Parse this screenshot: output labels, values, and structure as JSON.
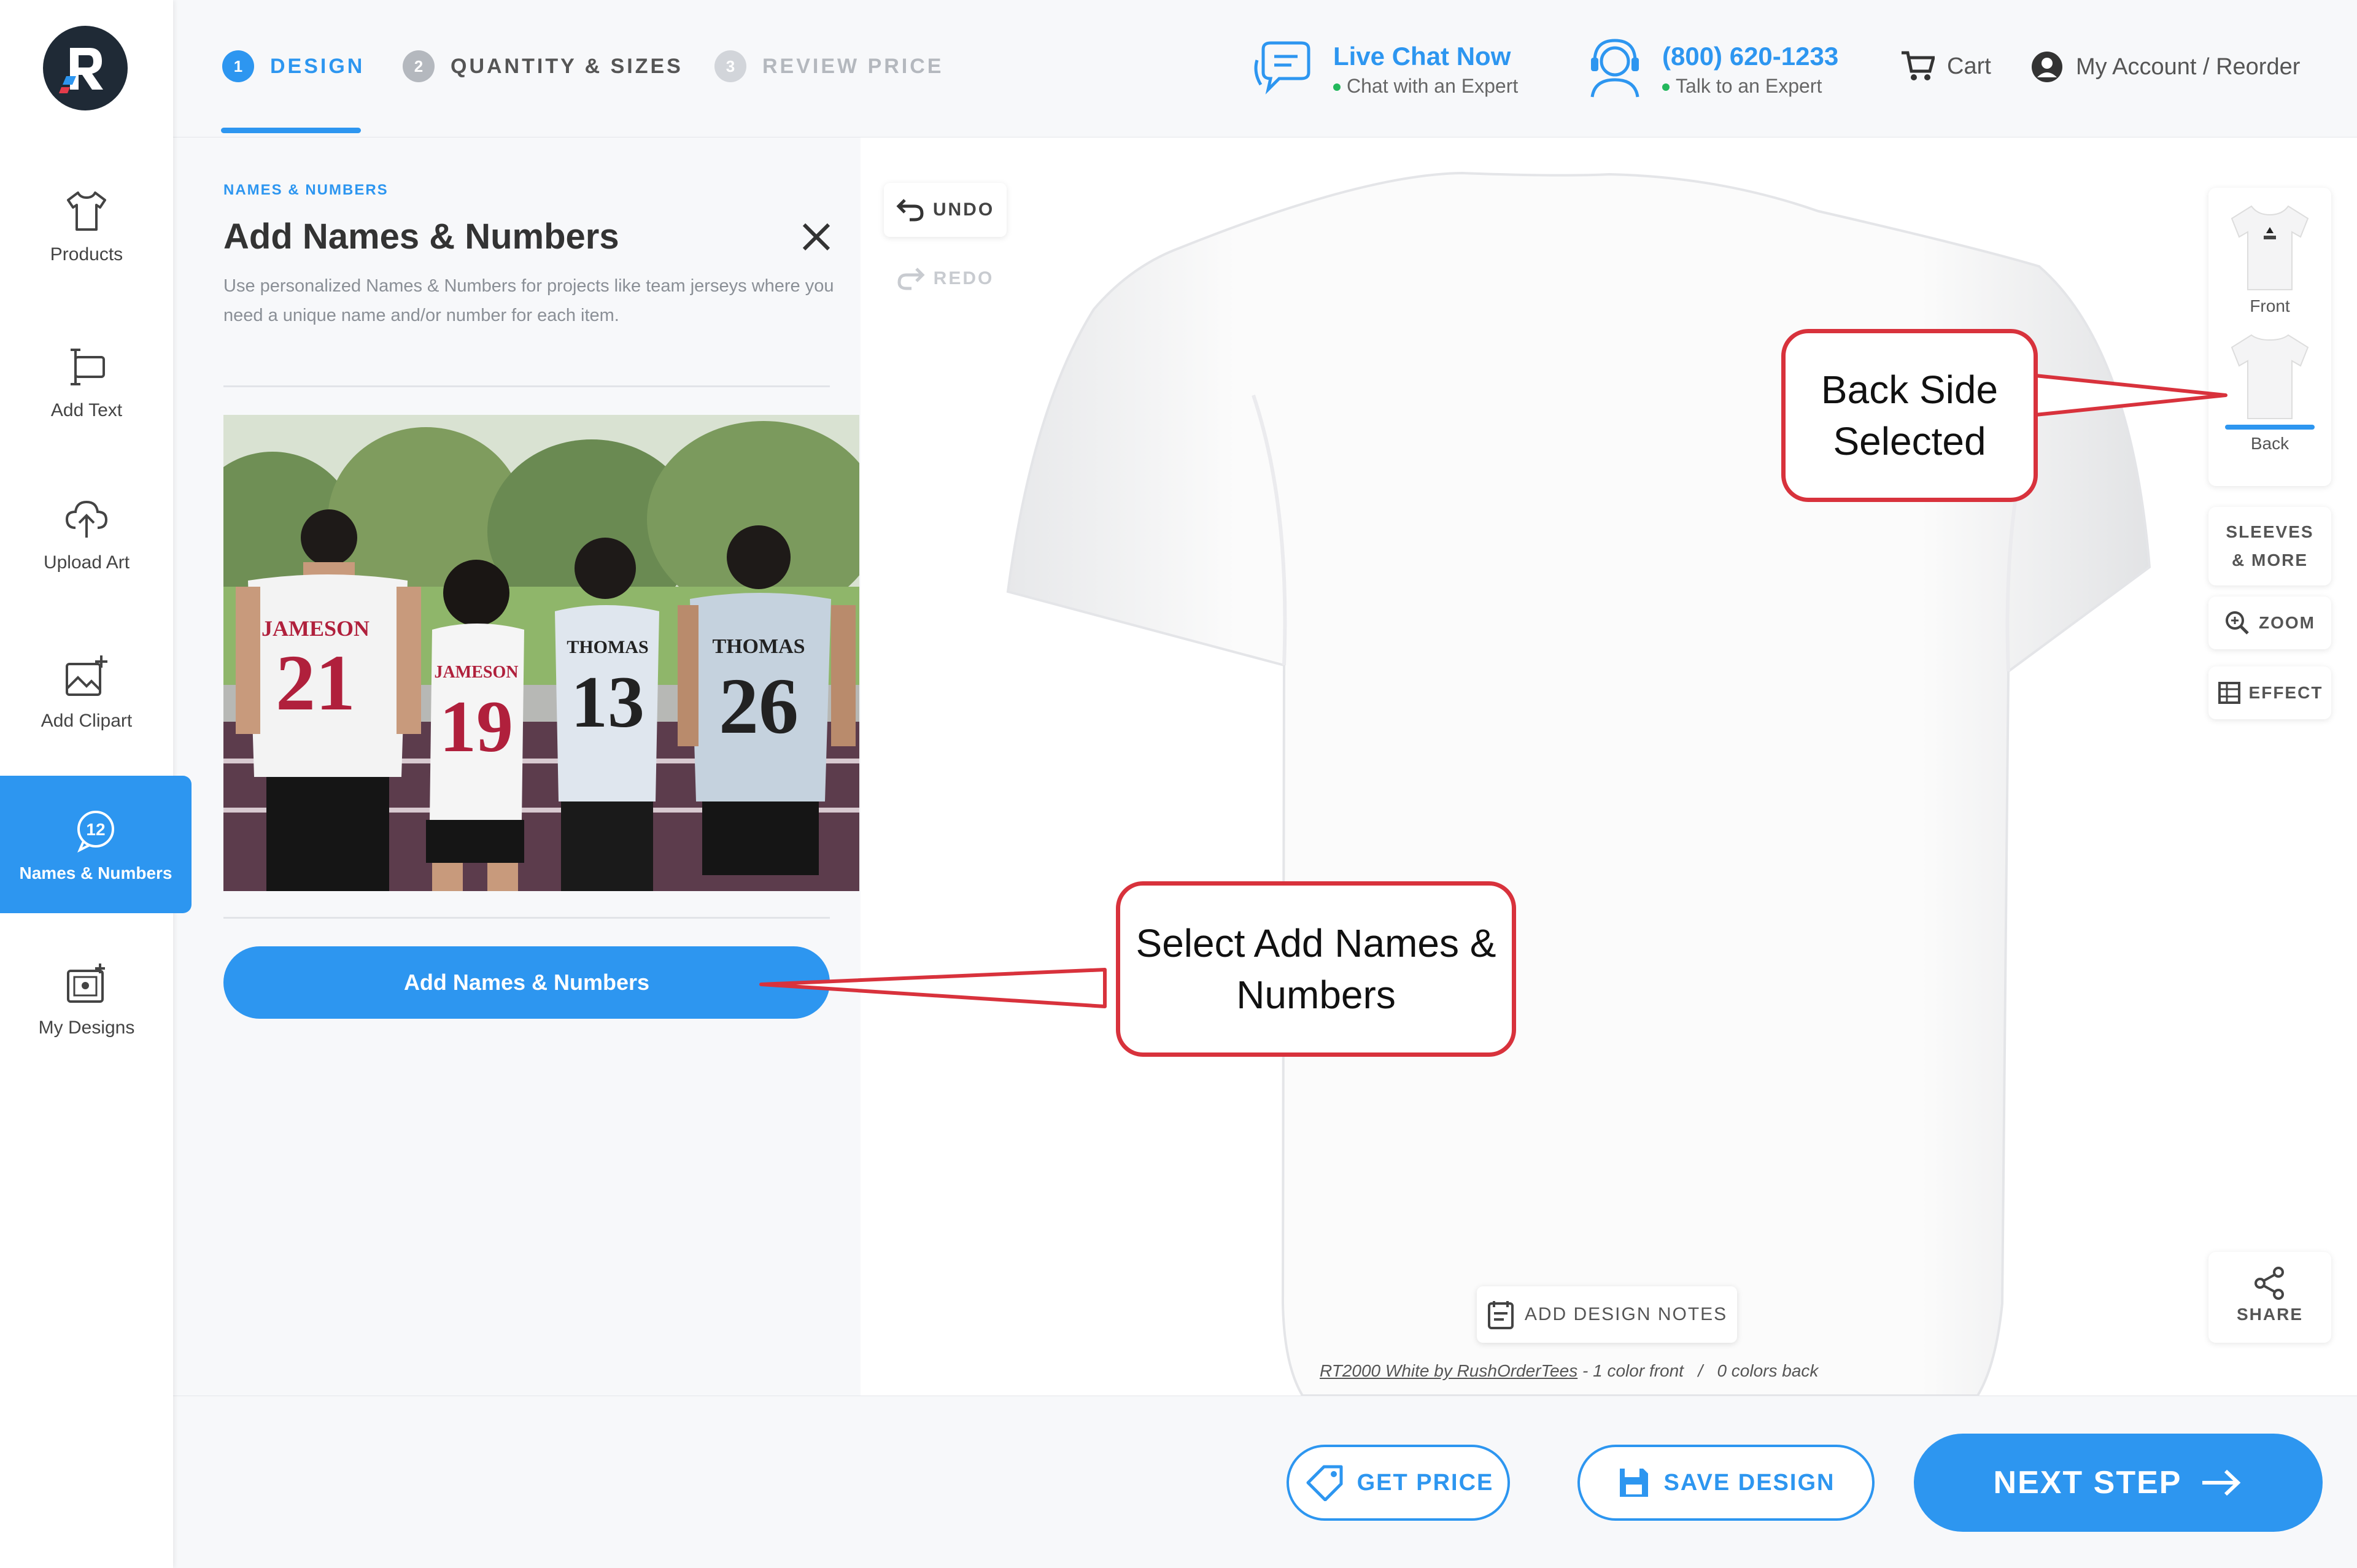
{
  "brand": {
    "logo_alt": "R logo"
  },
  "colors": {
    "accent": "#2d96f0",
    "callout_border": "#d8323c",
    "online_dot": "#23b85c"
  },
  "steps": [
    {
      "num": "1",
      "label": "DESIGN",
      "state": "active"
    },
    {
      "num": "2",
      "label": "QUANTITY & SIZES",
      "state": "next"
    },
    {
      "num": "3",
      "label": "REVIEW PRICE",
      "state": "disabled"
    }
  ],
  "header": {
    "chat_title": "Live Chat Now",
    "chat_sub": "Chat with an Expert",
    "phone_title": "(800) 620-1233",
    "phone_sub": "Talk to an Expert",
    "cart": "Cart",
    "account": "My Account / Reorder"
  },
  "sidebar": {
    "items": [
      {
        "label": "Products",
        "icon": "tshirt-icon"
      },
      {
        "label": "Add Text",
        "icon": "text-cursor-icon"
      },
      {
        "label": "Upload Art",
        "icon": "cloud-upload-icon"
      },
      {
        "label": "Add Clipart",
        "icon": "image-plus-icon"
      },
      {
        "label": "Names & Numbers",
        "icon": "number-badge-icon",
        "badge": "12"
      },
      {
        "label": "My Designs",
        "icon": "gallery-icon"
      }
    ]
  },
  "panel": {
    "kicker": "NAMES & NUMBERS",
    "title": "Add Names & Numbers",
    "description": "Use personalized Names & Numbers for projects like team jerseys where you need a unique name and/or number for each item.",
    "button": "Add Names & Numbers",
    "photo": {
      "jerseys": [
        {
          "name": "JAMESON",
          "number": "21",
          "color": "#b0203c"
        },
        {
          "name": "JAMESON",
          "number": "19",
          "color": "#b0203c"
        },
        {
          "name": "THOMAS",
          "number": "13",
          "color": "#222"
        },
        {
          "name": "THOMAS",
          "number": "26",
          "color": "#222"
        }
      ]
    }
  },
  "canvas": {
    "undo": "UNDO",
    "redo": "REDO",
    "views": [
      {
        "label": "Front"
      },
      {
        "label": "Back",
        "selected": true
      }
    ],
    "tools": [
      {
        "label": "SLEEVES & MORE"
      },
      {
        "label": "ZOOM",
        "icon": "zoom-icon"
      },
      {
        "label": "EFFECT",
        "icon": "effect-icon"
      },
      {
        "label": "SHARE",
        "icon": "share-icon"
      }
    ],
    "notes_button": "ADD DESIGN NOTES",
    "caption_product": "RT2000 White by RushOrderTees",
    "caption_front": "1 color front",
    "caption_sep": "/",
    "caption_back": "0 colors back"
  },
  "footer": {
    "get_price": "GET PRICE",
    "save_design": "SAVE DESIGN",
    "next_step": "NEXT STEP"
  },
  "callouts": {
    "back_side": "Back Side Selected",
    "add_names": "Select Add Names & Numbers"
  }
}
